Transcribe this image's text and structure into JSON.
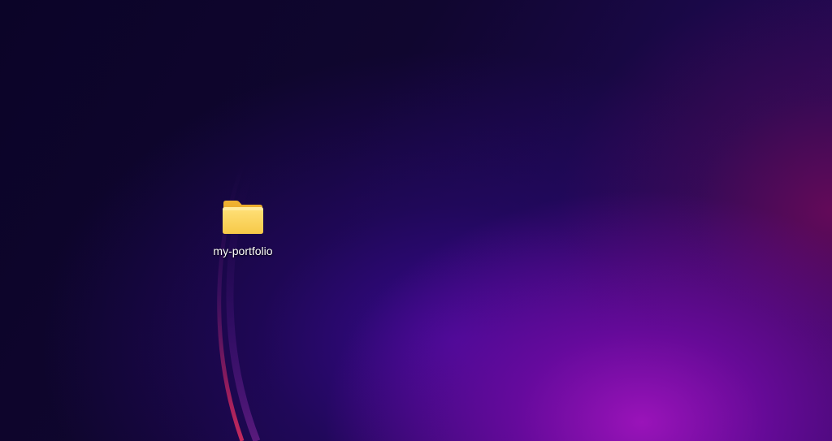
{
  "desktop": {
    "wallpaper_colors": {
      "base": "#10062f",
      "violet_glow": "#3a0a8a",
      "magenta_glow": "#a414c0",
      "crimson_edge": "#6a0a5a"
    },
    "icons": [
      {
        "label": "my-portfolio",
        "icon": "folder-icon"
      }
    ]
  }
}
